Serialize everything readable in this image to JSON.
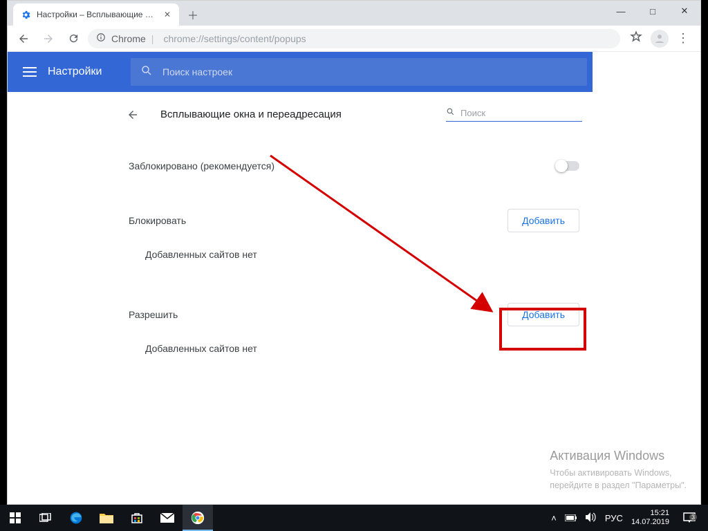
{
  "window": {
    "tab_title": "Настройки – Всплывающие окн",
    "minimize": "—",
    "maximize": "□",
    "close": "✕"
  },
  "addressbar": {
    "prefix": "Chrome",
    "path": "chrome://settings/content/popups"
  },
  "header": {
    "title": "Настройки",
    "search_placeholder": "Поиск настроек"
  },
  "page": {
    "back": "←",
    "title": "Всплывающие окна и переадресация",
    "search_placeholder": "Поиск",
    "blocked_row": "Заблокировано (рекомендуется)",
    "block_section": "Блокировать",
    "allow_section": "Разрешить",
    "add_button": "Добавить",
    "empty_text": "Добавленных сайтов нет"
  },
  "watermark": {
    "title": "Активация Windows",
    "line1": "Чтобы активировать Windows,",
    "line2": "перейдите в раздел \"Параметры\"."
  },
  "taskbar": {
    "lang": "РУС",
    "time": "15:21",
    "date": "14.07.2019",
    "notif_count": "3"
  }
}
